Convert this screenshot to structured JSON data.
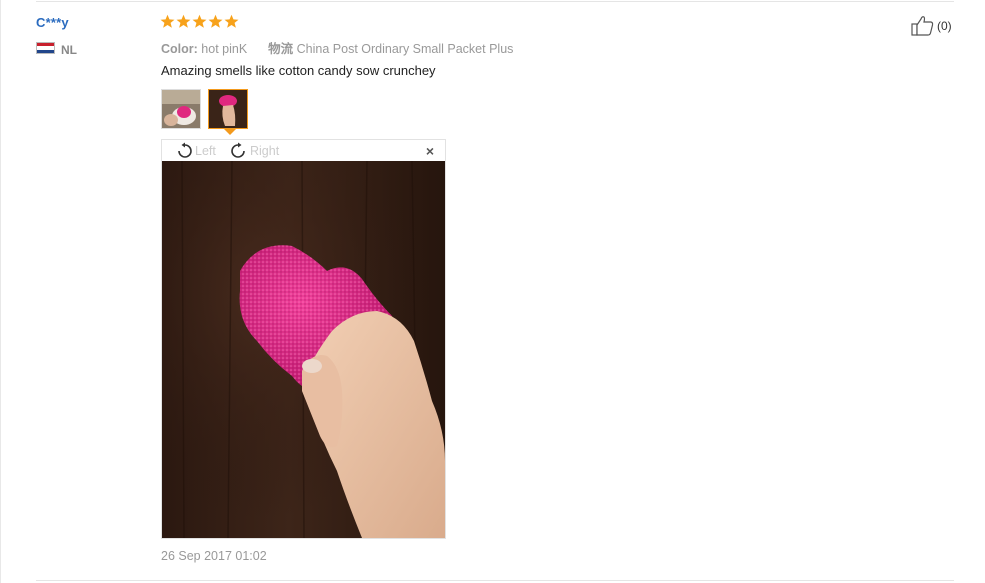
{
  "review": {
    "user_name": "C***y",
    "country_code": "NL",
    "rating": 5,
    "color_label": "Color:",
    "color_value": "hot pinK",
    "logistics_label": "物流",
    "logistics_value": "China Post Ordinary Small Packet Plus",
    "feedback": "Amazing smells like cotton candy sow crunchey",
    "date": "26 Sep 2017 01:02",
    "helpful_count": "(0)"
  },
  "viewer": {
    "rotate_left_label": "Left",
    "rotate_right_label": "Right",
    "close_symbol": "×"
  },
  "colors": {
    "star": "#f7a21b",
    "user_name": "#2a6bbf",
    "selected_thumb_border": "#f39a1d",
    "slime_pink": "#e0287f"
  },
  "icons": {
    "star": "star-icon",
    "flag": "flag-nl-icon",
    "rotate_left": "rotate-left-icon",
    "rotate_right": "rotate-right-icon",
    "close": "close-icon",
    "helpful": "thumbs-up-icon"
  }
}
